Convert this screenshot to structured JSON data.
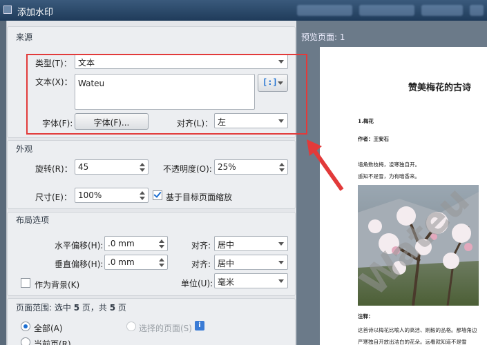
{
  "window": {
    "title": "添加水印"
  },
  "source": {
    "section_title": "来源",
    "type_label": "类型(T)：",
    "type_value": "文本",
    "text_label": "文本(X)：",
    "text_value": "Wateu",
    "font_label": "字体(F):",
    "font_button": "字体(F)...",
    "align_label": "对齐(L)：",
    "align_value": "左"
  },
  "appearance": {
    "section_title": "外观",
    "rotation_label": "旋转(R)：",
    "rotation_value": "45",
    "opacity_label": "不透明度(O):",
    "opacity_value": "25%",
    "size_label": "尺寸(E)：",
    "size_value": "100%",
    "scale_checkbox_label": "基于目标页面缩放",
    "scale_checked": true
  },
  "layout": {
    "section_title": "布局选项",
    "h_offset_label": "水平偏移(H):",
    "h_offset_value": ".0 mm",
    "h_align_label": "对齐:",
    "h_align_value": "居中",
    "v_offset_label": "垂直偏移(H):",
    "v_offset_value": ".0 mm",
    "v_align_label": "对齐:",
    "v_align_value": "居中",
    "background_label": "作为背景(K)",
    "background_checked": false,
    "unit_label": "单位(U):",
    "unit_value": "毫米"
  },
  "page_range": {
    "section_title_prefix": "页面范围: 选中 ",
    "selected": "5",
    "section_title_mid": " 页，共 ",
    "total": "5",
    "section_title_suffix": " 页",
    "all_label": "全部(A)",
    "selected_pages_label": "选择的页面(S)",
    "current_page_label": "当前页(R)"
  },
  "preview": {
    "label": "预览页面: 1",
    "doc_title": "赞美梅花的古诗",
    "lines": [
      "1.梅花",
      "作者：王安石",
      "墙角数枝梅，凌寒独自开。",
      "遥知不是雪，为有暗香来。",
      "注释：",
      "这首诗以梅花比喻人的高洁、刚毅的品格。那墙角边",
      "严寒独自开放出洁白的花朵。远看就知道不是雪"
    ],
    "watermark": "Wateu"
  },
  "colors": {
    "highlight_box": "#e23a3a",
    "accent": "#1c6fd1"
  }
}
